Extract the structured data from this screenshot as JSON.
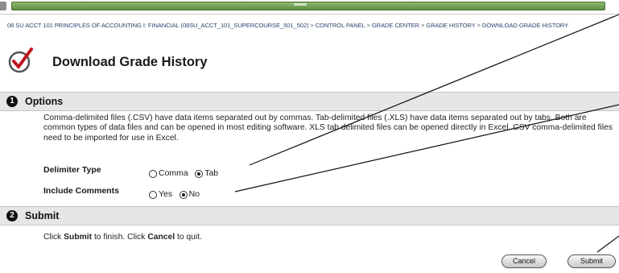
{
  "breadcrumb": {
    "course": "08 SU ACCT 101 PRINCIPLES OF ACCOUNTING I: FINANCIAL (08SU_ACCT_101_SUPERCOURSE_501_502)",
    "separator": ">",
    "control_panel": "CONTROL PANEL",
    "grade_center": "GRADE CENTER",
    "grade_history": "GRADE HISTORY",
    "current": "DOWNLOAD GRADE HISTORY"
  },
  "page": {
    "title": "Download Grade History",
    "title_icon": "red-checkmark-circle-icon"
  },
  "options": {
    "step": "1",
    "title": "Options",
    "description": "Comma-delimited files (.CSV) have data items separated out by commas. Tab-delimited files (.XLS) have data items separated out by tabs. Both are common types of data files and can be opened in most editing software. XLS tab delimited files can be opened directly in Excel. CSV comma-delimited files need to be imported for use in Excel.",
    "delimiter": {
      "label": "Delimiter Type",
      "choices": [
        {
          "label": "Comma",
          "checked": false
        },
        {
          "label": "Tab",
          "checked": true
        }
      ]
    },
    "comments": {
      "label": "Include Comments",
      "choices": [
        {
          "label": "Yes",
          "checked": false
        },
        {
          "label": "No",
          "checked": true
        }
      ]
    }
  },
  "submit": {
    "step": "2",
    "title": "Submit",
    "instruction_pre": "Click ",
    "instruction_submit": "Submit",
    "instruction_mid": " to finish. Click ",
    "instruction_cancel": "Cancel",
    "instruction_post": " to quit.",
    "cancel_label": "Cancel",
    "submit_label": "Submit"
  },
  "colors": {
    "topbar_green": "#6f9e52",
    "section_bg": "#e6e6e6",
    "breadcrumb_text": "#2a4670",
    "icon_red": "#c0141d"
  }
}
